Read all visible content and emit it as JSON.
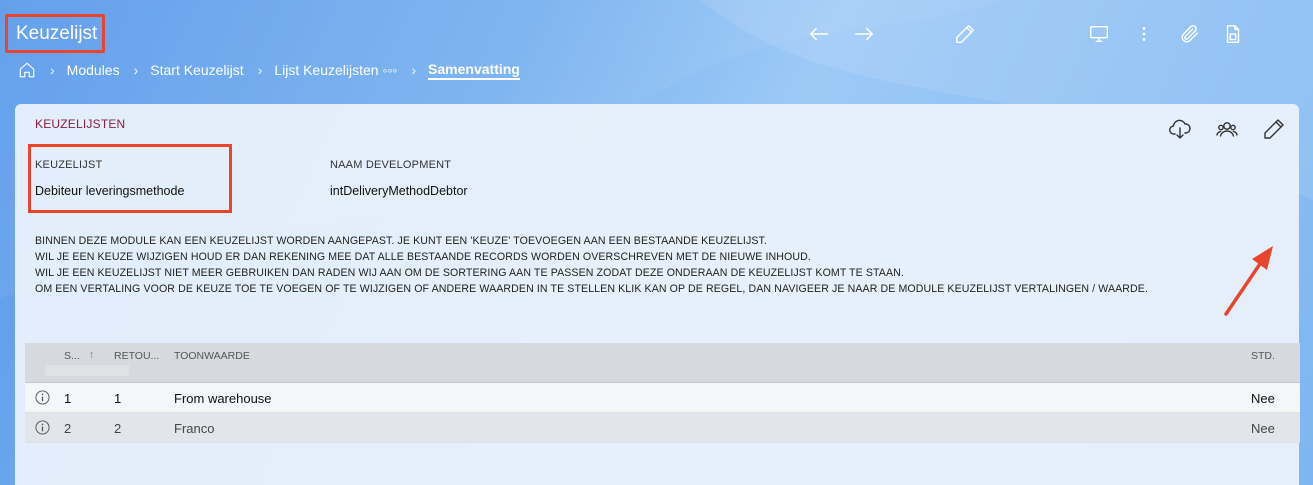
{
  "app": {
    "title": "Keuzelijst"
  },
  "toolbar": {
    "icons": [
      "arrow-left-icon",
      "arrow-right-icon",
      "pencil-icon",
      "monitor-icon",
      "more-vertical-icon",
      "paperclip-icon",
      "document-icon"
    ]
  },
  "breadcrumb": {
    "items": [
      "Modules",
      "Start Keuzelijst",
      "Lijst Keuzelijsten ◦◦◦",
      "Samenvatting"
    ]
  },
  "card": {
    "title": "KEUZELIJSTEN",
    "actions": [
      "cloud-download-icon",
      "users-icon",
      "edit-icon"
    ],
    "fields": [
      {
        "label": "KEUZELIJST",
        "value": "Debiteur leveringsmethode"
      },
      {
        "label": "NAAM DEVELOPMENT",
        "value": "intDeliveryMethodDebtor"
      }
    ],
    "description": [
      "BINNEN DEZE MODULE KAN EEN KEUZELIJST WORDEN AANGEPAST. JE KUNT EEN 'KEUZE' TOEVOEGEN AAN EEN BESTAANDE KEUZELIJST.",
      "WIL JE EEN KEUZE WIJZIGEN HOUD ER DAN REKENING MEE DAT ALLE BESTAANDE RECORDS WORDEN OVERSCHREVEN MET DE NIEUWE INHOUD.",
      "WIL JE EEN KEUZELIJST NIET MEER GEBRUIKEN DAN RADEN WIJ AAN OM DE SORTERING AAN TE PASSEN ZODAT DEZE ONDERAAN DE KEUZELIJST KOMT TE STAAN.",
      "OM EEN VERTALING VOOR DE KEUZE TOE TE VOEGEN OF TE WIJZIGEN OF ANDERE WAARDEN IN TE STELLEN KLIK KAN OP DE REGEL, DAN NAVIGEER JE NAAR DE MODULE KEUZELIJST VERTALINGEN / WAARDE."
    ]
  },
  "grid": {
    "columns": {
      "sort": "S...",
      "sort_icon": "↑",
      "return": "RETOU...",
      "display": "TOONWAARDE",
      "std": "STD."
    },
    "rows": [
      {
        "sort": "1",
        "return": "1",
        "display": "From warehouse",
        "std": "Nee"
      },
      {
        "sort": "2",
        "return": "2",
        "display": "Franco",
        "std": "Nee"
      }
    ]
  },
  "colors": {
    "accent_highlight": "#e8452c",
    "card_title": "#8b1f3d"
  }
}
